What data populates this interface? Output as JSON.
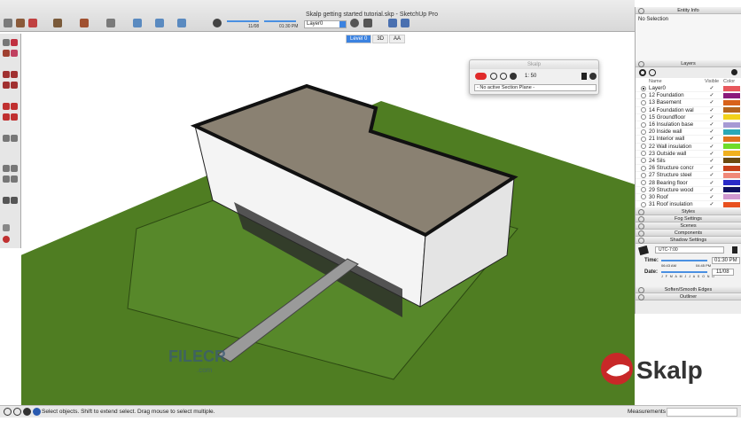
{
  "window": {
    "title": "Skalp getting started tutorial.skp - SketchUp Pro"
  },
  "toolbar": {
    "date_value": "11/08",
    "time_value": "01:30 PM",
    "layer_select": "Layer0"
  },
  "view_tabs": [
    {
      "label": "Level 0",
      "active": true
    },
    {
      "label": "3D",
      "active": false
    },
    {
      "label": "AA",
      "active": false
    }
  ],
  "skalp_dialog": {
    "title": "Skalp",
    "scale": "1: 50",
    "section_plane": "- No active Section Plane -"
  },
  "entity_info": {
    "title": "Entity Info",
    "selection": "No Selection"
  },
  "layers": {
    "title": "Layers",
    "columns": [
      "Name",
      "Visible",
      "Color"
    ],
    "items": [
      {
        "name": "Layer0",
        "visible": "✓",
        "color": "#e8585d",
        "current": true
      },
      {
        "name": "12 Foundation",
        "visible": "✓",
        "color": "#8b1a7c"
      },
      {
        "name": "13 Basement",
        "visible": "✓",
        "color": "#d8621a"
      },
      {
        "name": "14 Foundation wal",
        "visible": "✓",
        "color": "#b5651d"
      },
      {
        "name": "15 Groundfloor",
        "visible": "✓",
        "color": "#f2d21a"
      },
      {
        "name": "16 Insulation base",
        "visible": "✓",
        "color": "#a69ad4"
      },
      {
        "name": "20 Inside wall",
        "visible": "✓",
        "color": "#2aa8b8"
      },
      {
        "name": "21 Interior wall",
        "visible": "✓",
        "color": "#e0731e"
      },
      {
        "name": "22 Wall insulation",
        "visible": "✓",
        "color": "#6fdc2a"
      },
      {
        "name": "23 Outside wall",
        "visible": "✓",
        "color": "#f0b01e"
      },
      {
        "name": "24 Sils",
        "visible": "✓",
        "color": "#6b4a10"
      },
      {
        "name": "26 Structure concr",
        "visible": "✓",
        "color": "#c8401a"
      },
      {
        "name": "27 Structure steel",
        "visible": "✓",
        "color": "#f08878"
      },
      {
        "name": "28 Bearing floor",
        "visible": "✓",
        "color": "#2a2ac8"
      },
      {
        "name": "29 Structure wood",
        "visible": "✓",
        "color": "#101060"
      },
      {
        "name": "30 Roof",
        "visible": "✓",
        "color": "#d098d0"
      },
      {
        "name": "31 Roof insulation",
        "visible": "✓",
        "color": "#e8501e"
      }
    ]
  },
  "panels": {
    "styles": "Styles",
    "fog": "Fog Settings",
    "scenes": "Scenes",
    "components": "Components",
    "shadow": "Shadow Settings",
    "soften": "Soften/Smooth Edges",
    "outliner": "Outliner"
  },
  "shadow": {
    "timezone": "UTC-7:00",
    "time_label": "Time:",
    "date_label": "Date:",
    "time_start": "06:43 AM",
    "time_end": "04:45 PM",
    "time_value": "01:30 PM",
    "date_value": "11/08",
    "months": "J F M A M J J A S O N D"
  },
  "status": {
    "message": "Select objects. Shift to extend select. Drag mouse to select multiple.",
    "measurements_label": "Measurements"
  },
  "watermark": {
    "text": "FILECR",
    "sub": ".com"
  },
  "logo": {
    "text": "Skalp"
  }
}
